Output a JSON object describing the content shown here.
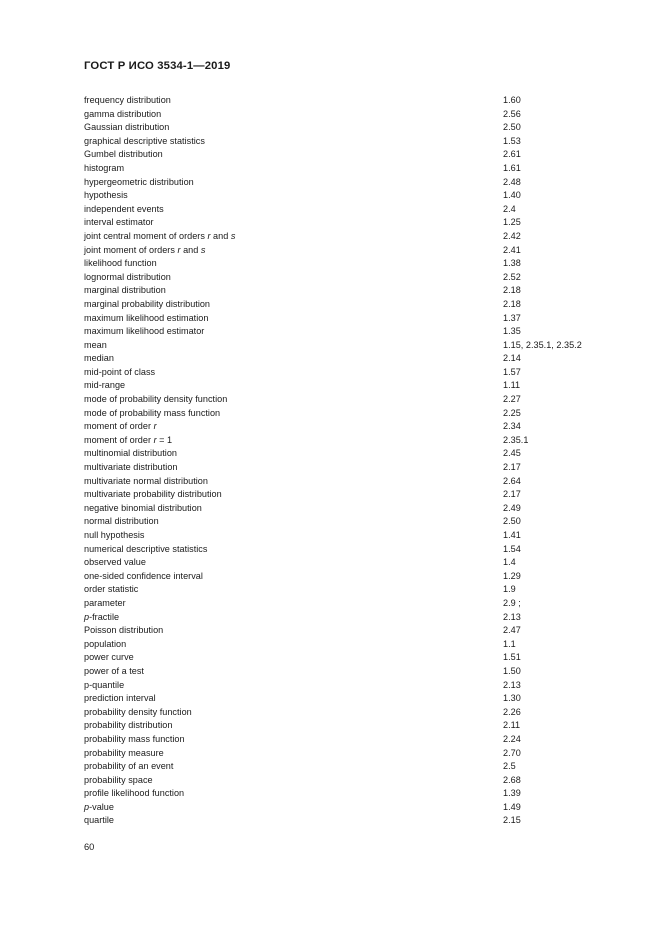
{
  "header": {
    "standard_title": "ГОСТ Р ИСО 3534-1—2019"
  },
  "footer": {
    "page_number": "60"
  },
  "index": {
    "entries": [
      {
        "term": "frequency distribution",
        "ref": "1.60"
      },
      {
        "term": "gamma distribution",
        "ref": "2.56"
      },
      {
        "term": "Gaussian distribution",
        "ref": "2.50"
      },
      {
        "term": "graphical descriptive statistics",
        "ref": "1.53"
      },
      {
        "term": "Gumbel distribution",
        "ref": "2.61"
      },
      {
        "term": "histogram",
        "ref": "1.61"
      },
      {
        "term": "hypergeometric distribution",
        "ref": "2.48"
      },
      {
        "term": "hypothesis",
        "ref": "1.40"
      },
      {
        "term": "independent events",
        "ref": "2.4"
      },
      {
        "term": "interval estimator",
        "ref": "1.25"
      },
      {
        "term": "joint central moment of orders r and s",
        "ref": "2.42",
        "italics": [
          "r",
          "s"
        ]
      },
      {
        "term": "joint moment of orders r and s",
        "ref": "2.41",
        "italics": [
          "r",
          "s"
        ]
      },
      {
        "term": "likelihood function",
        "ref": "1.38"
      },
      {
        "term": "lognormal distribution",
        "ref": "2.52"
      },
      {
        "term": "marginal distribution",
        "ref": "2.18"
      },
      {
        "term": "marginal probability distribution",
        "ref": "2.18"
      },
      {
        "term": "maximum likelihood estimation",
        "ref": "1.37"
      },
      {
        "term": "maximum likelihood estimator",
        "ref": "1.35"
      },
      {
        "term": "mean",
        "ref": "1.15, 2.35.1, 2.35.2"
      },
      {
        "term": "median",
        "ref": "2.14"
      },
      {
        "term": "mid-point of class",
        "ref": "1.57"
      },
      {
        "term": "mid-range",
        "ref": "1.11"
      },
      {
        "term": "mode of probability density function",
        "ref": "2.27"
      },
      {
        "term": "mode of probability mass function",
        "ref": "2.25"
      },
      {
        "term": "moment of order r",
        "ref": "2.34",
        "italics": [
          "r"
        ]
      },
      {
        "term": "moment of order r = 1",
        "ref": "2.35.1",
        "italics": [
          "r"
        ]
      },
      {
        "term": "multinomial distribution",
        "ref": "2.45"
      },
      {
        "term": "multivariate distribution",
        "ref": "2.17"
      },
      {
        "term": "multivariate normal distribution",
        "ref": "2.64"
      },
      {
        "term": "multivariate probability distribution",
        "ref": "2.17"
      },
      {
        "term": "negative binomial distribution",
        "ref": "2.49"
      },
      {
        "term": "normal distribution",
        "ref": "2.50"
      },
      {
        "term": "null hypothesis",
        "ref": "1.41"
      },
      {
        "term": "numerical descriptive statistics",
        "ref": "1.54"
      },
      {
        "term": "observed value",
        "ref": "1.4"
      },
      {
        "term": "one-sided confidence interval",
        "ref": "1.29"
      },
      {
        "term": "order statistic",
        "ref": "1.9"
      },
      {
        "term": "parameter",
        "ref": "2.9 ;"
      },
      {
        "term": "p-fractile",
        "ref": "2.13",
        "italics": [
          "p"
        ]
      },
      {
        "term": "Poisson distribution",
        "ref": "2.47"
      },
      {
        "term": "population",
        "ref": "1.1"
      },
      {
        "term": "power curve",
        "ref": "1.51"
      },
      {
        "term": "power of a test",
        "ref": "1.50"
      },
      {
        "term": "p-quantile",
        "ref": "2.13"
      },
      {
        "term": "prediction interval",
        "ref": "1.30"
      },
      {
        "term": "probability density function",
        "ref": "2.26"
      },
      {
        "term": "probability distribution",
        "ref": "2.11"
      },
      {
        "term": "probability mass function",
        "ref": "2.24"
      },
      {
        "term": "probability measure",
        "ref": "2.70"
      },
      {
        "term": "probability of an event",
        "ref": "2.5"
      },
      {
        "term": "probability space",
        "ref": "2.68"
      },
      {
        "term": "profile likelihood function",
        "ref": "1.39"
      },
      {
        "term": "p-value",
        "ref": "1.49",
        "italics": [
          "p"
        ]
      },
      {
        "term": "quartile",
        "ref": "2.15"
      }
    ]
  }
}
